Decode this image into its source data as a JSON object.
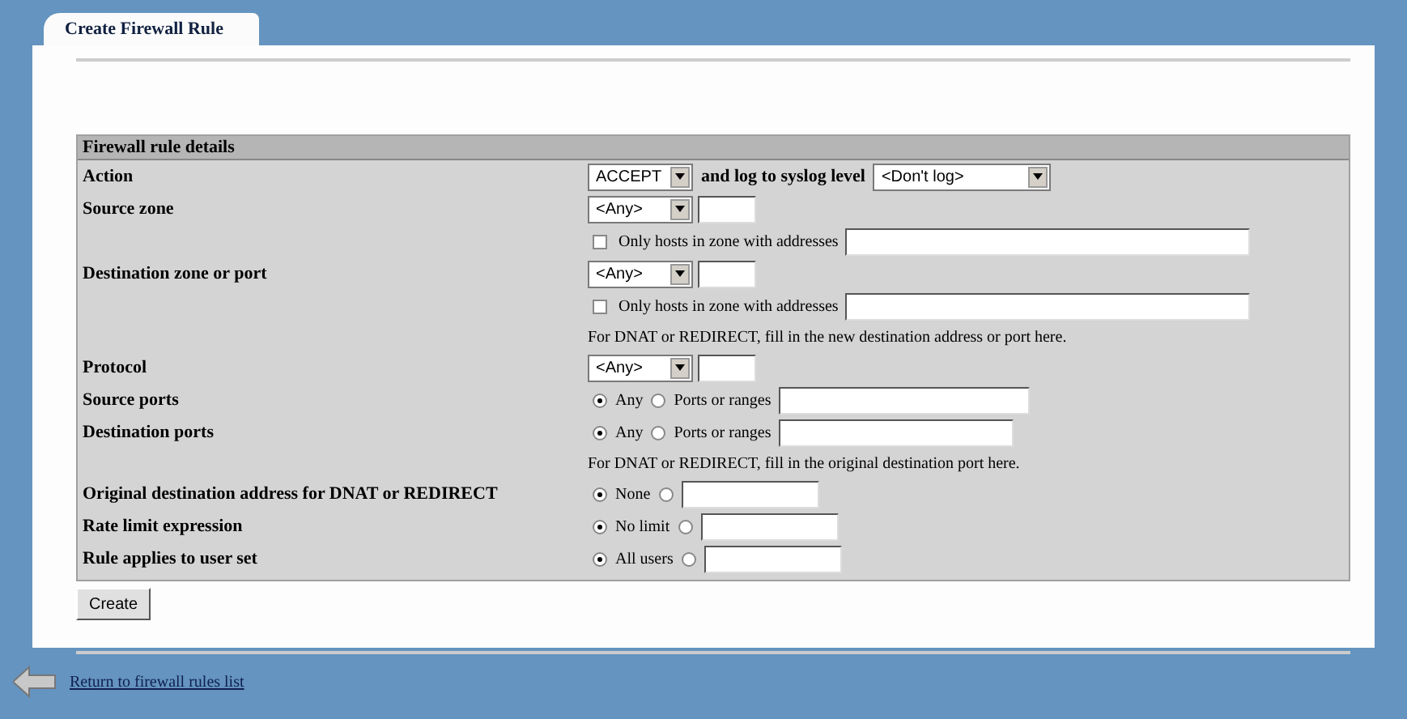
{
  "tab": {
    "label": "Create Firewall Rule",
    "selected": true
  },
  "section": {
    "title": "Firewall rule details"
  },
  "rows": [
    {
      "label": "Action",
      "lines": [
        {
          "kind": "action",
          "value": "ACCEPT",
          "text": "and log to syslog level",
          "value2": "<Don't log>"
        }
      ]
    },
    {
      "label": "Source zone",
      "lines": [
        {
          "kind": "select_field",
          "value": "<Any>"
        },
        {
          "kind": "checkbox_field",
          "checked": false,
          "text": "Only hosts in zone with addresses"
        }
      ]
    },
    {
      "label": "Destination zone or port",
      "lines": [
        {
          "kind": "select_field",
          "value": "<Any>"
        },
        {
          "kind": "checkbox_field",
          "checked": false,
          "text": "Only hosts in zone with addresses"
        },
        {
          "kind": "note",
          "text": "For DNAT or REDIRECT, fill in the new destination address or port here."
        }
      ]
    },
    {
      "label": "Protocol",
      "lines": [
        {
          "kind": "select_field",
          "value": "<Any>"
        }
      ]
    },
    {
      "label": "Source ports",
      "lines": [
        {
          "kind": "radio_field",
          "options": [
            {
              "label": "Any",
              "selected": true
            },
            {
              "label": "Ports or ranges",
              "selected": false
            }
          ]
        }
      ]
    },
    {
      "label": "Destination ports",
      "lines": [
        {
          "kind": "radio_field",
          "options": [
            {
              "label": "Any",
              "selected": true
            },
            {
              "label": "Ports or ranges",
              "selected": false
            }
          ]
        },
        {
          "kind": "note",
          "text": "For DNAT or REDIRECT, fill in the original destination port here."
        }
      ]
    },
    {
      "label": "Original destination address for DNAT or REDIRECT",
      "lines": [
        {
          "kind": "radio_field",
          "options": [
            {
              "label": "None",
              "selected": true
            },
            {
              "selected": false
            }
          ]
        }
      ]
    },
    {
      "label": "Rate limit expression",
      "lines": [
        {
          "kind": "radio_field",
          "options": [
            {
              "label": "No limit",
              "selected": true
            },
            {
              "selected": false
            }
          ]
        }
      ]
    },
    {
      "label": "Rule applies to user set",
      "lines": [
        {
          "kind": "radio_field",
          "options": [
            {
              "label": "All users",
              "selected": true
            },
            {
              "selected": false
            }
          ]
        }
      ]
    }
  ],
  "create_button": "Create",
  "return_link": "Return to firewall rules list"
}
